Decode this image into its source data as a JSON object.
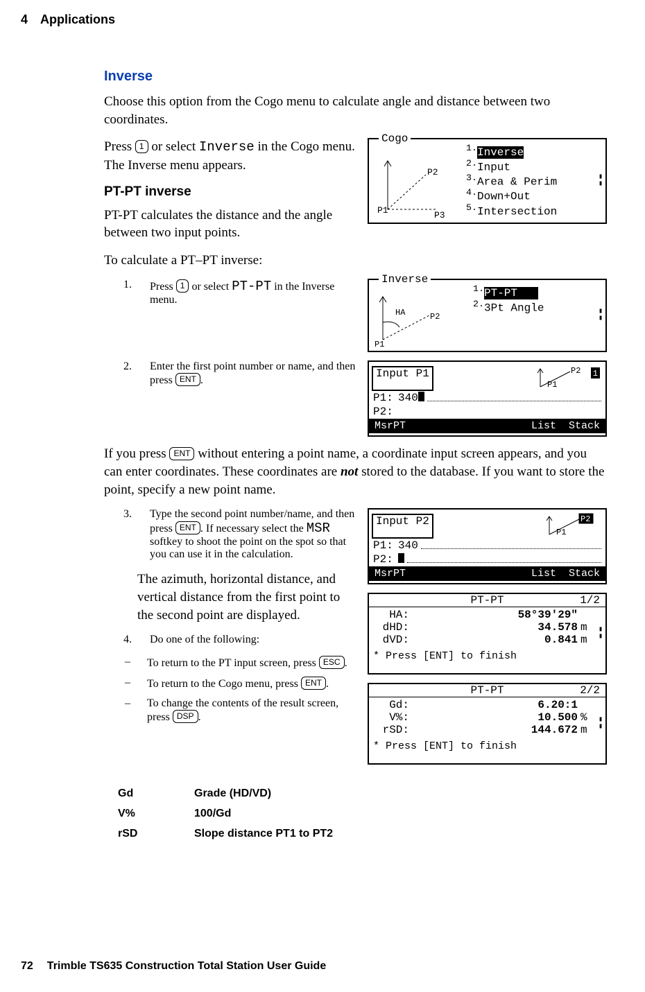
{
  "header": {
    "chapter_number": "4",
    "chapter_title": "Applications"
  },
  "section": {
    "title": "Inverse",
    "intro": "Choose this option from the Cogo menu to calculate angle and distance between two coordinates.",
    "press_text_a": "Press ",
    "key_1": "1",
    "press_text_b": " or select ",
    "inverse_token": "Inverse",
    "press_text_c": " in the Cogo menu. The Inverse menu appears."
  },
  "ptpt": {
    "heading": "PT-PT inverse",
    "desc": "PT-PT calculates the distance and the angle between two input points.",
    "intro": "To calculate a PT–PT inverse:",
    "step1_a": "Press ",
    "step1_key": "1",
    "step1_b": " or select ",
    "step1_token": "PT-PT",
    "step1_c": " in the Inverse menu.",
    "step2_a": "Enter the first point number or name, and then press ",
    "step2_key": "ENT",
    "step2_b": ".",
    "note_a": "If you press ",
    "note_key": "ENT",
    "note_b": " without entering a point name, a coordinate input screen appears, and you can enter coordinates. These coordinates are ",
    "note_em": "not",
    "note_c": " stored to the database. If you want to store the point, specify a new point name.",
    "step3_a": "Type the second point number/name, and then press ",
    "step3_key1": "ENT",
    "step3_b": ". If necessary select the ",
    "step3_msr": "MSR",
    "step3_c": " softkey to shoot the point on the spot so that you can use it in the calculation.",
    "step3_d": "The azimuth, horizontal distance, and vertical distance from the first point to the second point are displayed.",
    "step4": "Do one of the following:",
    "opt1_a": "To return to the PT input screen, press ",
    "opt1_key": "ESC",
    "opt1_b": ".",
    "opt2_a": "To return to the Cogo menu, press ",
    "opt2_key": "ENT",
    "opt2_b": ".",
    "opt3_a": "To change the contents of the result screen, press ",
    "opt3_key": "DSP",
    "opt3_b": "."
  },
  "defs": {
    "r1k": "Gd",
    "r1v": "Grade (HD/VD)",
    "r2k": "V%",
    "r2v": "100/Gd",
    "r3k": "rSD",
    "r3v": "Slope distance PT1 to PT2"
  },
  "footer": {
    "page": "72",
    "book": "Trimble TS635 Construction Total Station User Guide"
  },
  "screens": {
    "cogo": {
      "title": "Cogo",
      "items": [
        "Inverse",
        "Input",
        "Area & Perim",
        "Down+Out",
        "Intersection"
      ],
      "p1": "P1",
      "p2": "P2",
      "p3": "P3"
    },
    "inverse": {
      "title": "Inverse",
      "items": [
        "PT-PT",
        "3Pt Angle"
      ],
      "ha": "HA",
      "p1": "P1",
      "p2": "P2"
    },
    "inputP1": {
      "title": "Input P1",
      "p1lab": "P1:",
      "p1val": "340",
      "p2lab": "P2:",
      "soft1": "MsrPT",
      "soft2": "List",
      "soft3": "Stack",
      "d1": "P1",
      "d2": "P2",
      "badge": "1"
    },
    "inputP2": {
      "title": "Input P2",
      "p1lab": "P1:",
      "p1val": "340",
      "p2lab": "P2:",
      "soft1": "MsrPT",
      "soft2": "List",
      "soft3": "Stack",
      "d1": "P1",
      "d2": "P2"
    },
    "result1": {
      "title": "PT-PT",
      "page": "1/2",
      "r1lab": "HA:",
      "r1val": "58°39'29\"",
      "r2lab": "dHD:",
      "r2val": "34.578",
      "r2u": "m",
      "r3lab": "dVD:",
      "r3val": "0.841",
      "r3u": "m",
      "hint": "* Press [ENT] to finish"
    },
    "result2": {
      "title": "PT-PT",
      "page": "2/2",
      "r1lab": "Gd:",
      "r1val": "6.20:1",
      "r2lab": "V%:",
      "r2val": "10.500",
      "r2u": "%",
      "r3lab": "rSD:",
      "r3val": "144.672",
      "r3u": "m",
      "hint": "* Press [ENT] to finish"
    }
  }
}
